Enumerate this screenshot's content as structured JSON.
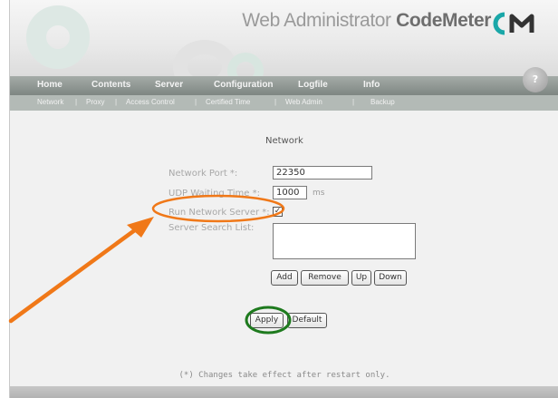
{
  "header": {
    "title_prefix": "Web Administrator ",
    "title_brand": "CodeMeter",
    "help_label": "?"
  },
  "main_nav": [
    {
      "label": "Home"
    },
    {
      "label": "Contents"
    },
    {
      "label": "Server"
    },
    {
      "label": "Configuration"
    },
    {
      "label": "Logfile"
    },
    {
      "label": "Info"
    }
  ],
  "sub_nav": [
    {
      "label": "Network"
    },
    {
      "label": "Proxy"
    },
    {
      "label": "Access Control"
    },
    {
      "label": "Certified Time"
    },
    {
      "label": "Web Admin"
    },
    {
      "label": "Backup"
    }
  ],
  "sub_nav_separator": "|",
  "page": {
    "title": "Network",
    "network_port": {
      "label": "Network Port *:",
      "value": "22350"
    },
    "udp_wait": {
      "label": "UDP Waiting Time *:",
      "value": "1000",
      "unit": "ms"
    },
    "run_server": {
      "label": "Run Network Server *:",
      "checked": true,
      "check_glyph": "✓"
    },
    "search_list": {
      "label": "Server Search List:"
    },
    "buttons": {
      "add": "Add",
      "remove": "Remove",
      "up": "Up",
      "down": "Down"
    },
    "apply": "Apply",
    "default": "Default",
    "note": "(*) Changes take effect after restart only."
  },
  "colors": {
    "annotation_orange": "#f07818",
    "annotation_green": "#1e7a1e",
    "nav_bar": "#8c9490",
    "sub_nav_bar": "#b3bab6"
  },
  "icons": {
    "logo": "codemeter-cm-logo",
    "help": "help-icon",
    "arrow": "annotation-arrow"
  }
}
